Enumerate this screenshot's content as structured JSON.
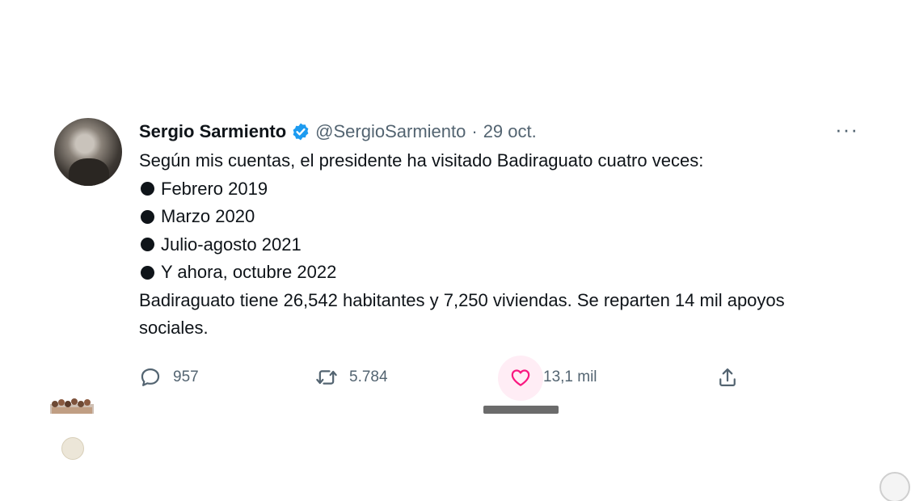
{
  "tweet": {
    "author_name": "Sergio Sarmiento",
    "handle": "@SergioSarmiento",
    "separator": "·",
    "date": "29 oct.",
    "more_label": "···",
    "intro": "Según mis cuentas, el presidente ha visitado Badiraguato cuatro veces:",
    "visits": [
      "Febrero 2019",
      "Marzo 2020",
      "Julio-agosto 2021",
      "Y ahora, octubre 2022"
    ],
    "closing": "Badiraguato tiene 26,542 habitantes y 7,250 viviendas. Se reparten 14 mil apoyos sociales."
  },
  "actions": {
    "replies": "957",
    "retweets": "5.784",
    "likes": "13,1 mil"
  },
  "colors": {
    "verified_blue": "#1d9bf0",
    "like_pink": "#f91880",
    "secondary_text": "#536471",
    "primary_text": "#0f1419"
  },
  "icons": {
    "reply": "speech-bubble-icon",
    "retweet": "retweet-arrows-icon",
    "like": "heart-icon",
    "share": "share-upload-icon",
    "more": "more-dots-icon",
    "verified": "verified-badge-icon"
  }
}
